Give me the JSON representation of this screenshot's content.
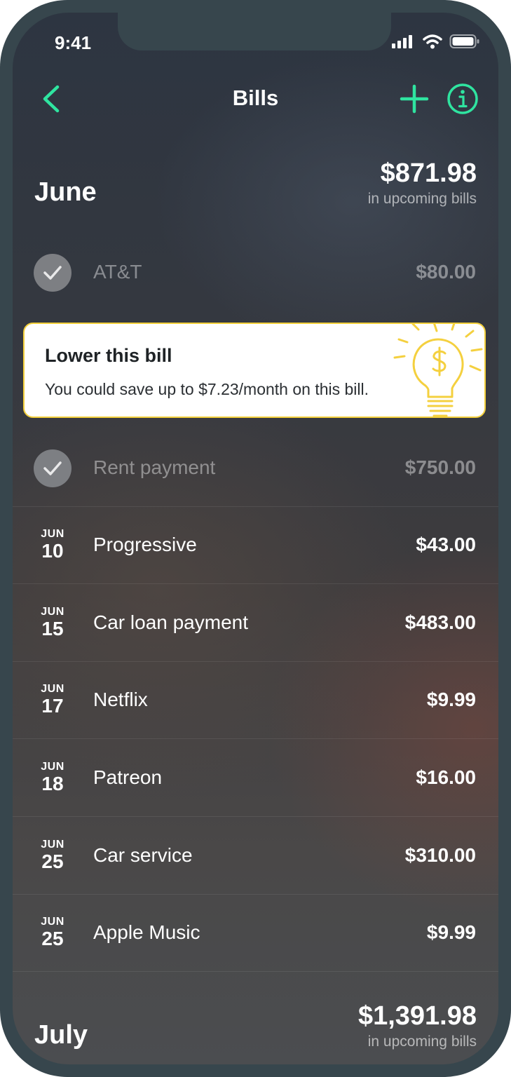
{
  "status_bar": {
    "time": "9:41"
  },
  "nav": {
    "title": "Bills"
  },
  "months": [
    {
      "name": "June",
      "total": "$871.98",
      "subtitle": "in upcoming bills"
    },
    {
      "name": "July",
      "total": "$1,391.98",
      "subtitle": "in upcoming bills"
    }
  ],
  "bills": [
    {
      "paid": true,
      "name": "AT&T",
      "amount": "$80.00"
    },
    {
      "paid": true,
      "name": "Rent payment",
      "amount": "$750.00"
    },
    {
      "paid": false,
      "month": "JUN",
      "day": "10",
      "name": "Progressive",
      "amount": "$43.00"
    },
    {
      "paid": false,
      "month": "JUN",
      "day": "15",
      "name": "Car loan payment",
      "amount": "$483.00"
    },
    {
      "paid": false,
      "month": "JUN",
      "day": "17",
      "name": "Netflix",
      "amount": "$9.99"
    },
    {
      "paid": false,
      "month": "JUN",
      "day": "18",
      "name": "Patreon",
      "amount": "$16.00"
    },
    {
      "paid": false,
      "month": "JUN",
      "day": "25",
      "name": "Car service",
      "amount": "$310.00"
    },
    {
      "paid": false,
      "month": "JUN",
      "day": "25",
      "name": "Apple Music",
      "amount": "$9.99"
    }
  ],
  "tip": {
    "title": "Lower this bill",
    "text": "You could save up to $7.23/month on this bill."
  },
  "colors": {
    "accent": "#2fe4a0",
    "tip_border": "#f2cf3b",
    "tip_icon": "#f4d03f"
  },
  "icons": [
    "back-arrow-icon",
    "plus-icon",
    "info-icon",
    "checkmark-icon",
    "lightbulb-dollar-icon",
    "signal-icon",
    "wifi-icon",
    "battery-icon"
  ]
}
